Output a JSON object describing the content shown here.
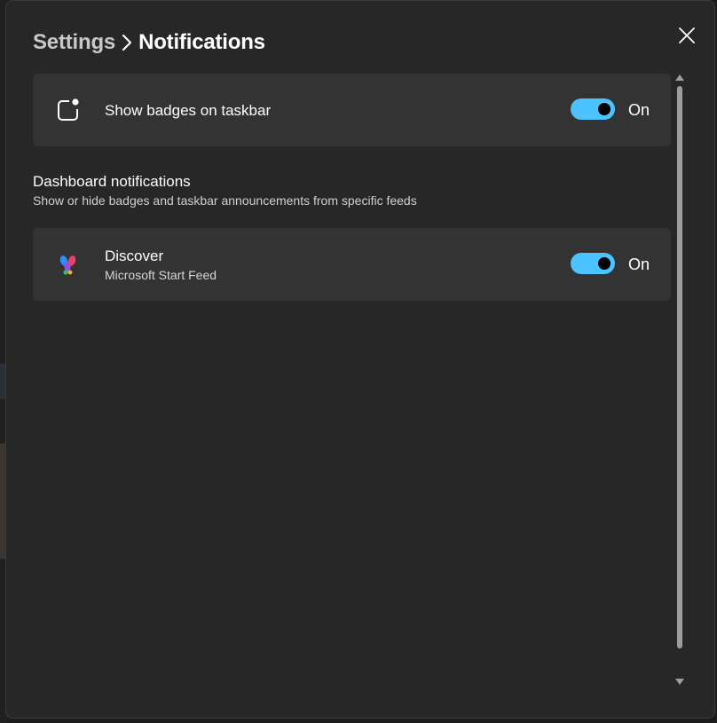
{
  "header": {
    "parent": "Settings",
    "current": "Notifications"
  },
  "taskbar_badges": {
    "label": "Show badges on taskbar",
    "toggle_state": "On",
    "enabled": true,
    "icon": "taskbar-badge-icon"
  },
  "dashboard": {
    "title": "Dashboard notifications",
    "subtitle": "Show or hide badges and taskbar announcements from specific feeds",
    "feeds": [
      {
        "name": "Discover",
        "source": "Microsoft Start Feed",
        "toggle_state": "On",
        "enabled": true,
        "icon": "microsoft-start-icon"
      }
    ]
  },
  "colors": {
    "accent": "#4cc2ff",
    "panel": "#272727",
    "card": "#333333"
  }
}
